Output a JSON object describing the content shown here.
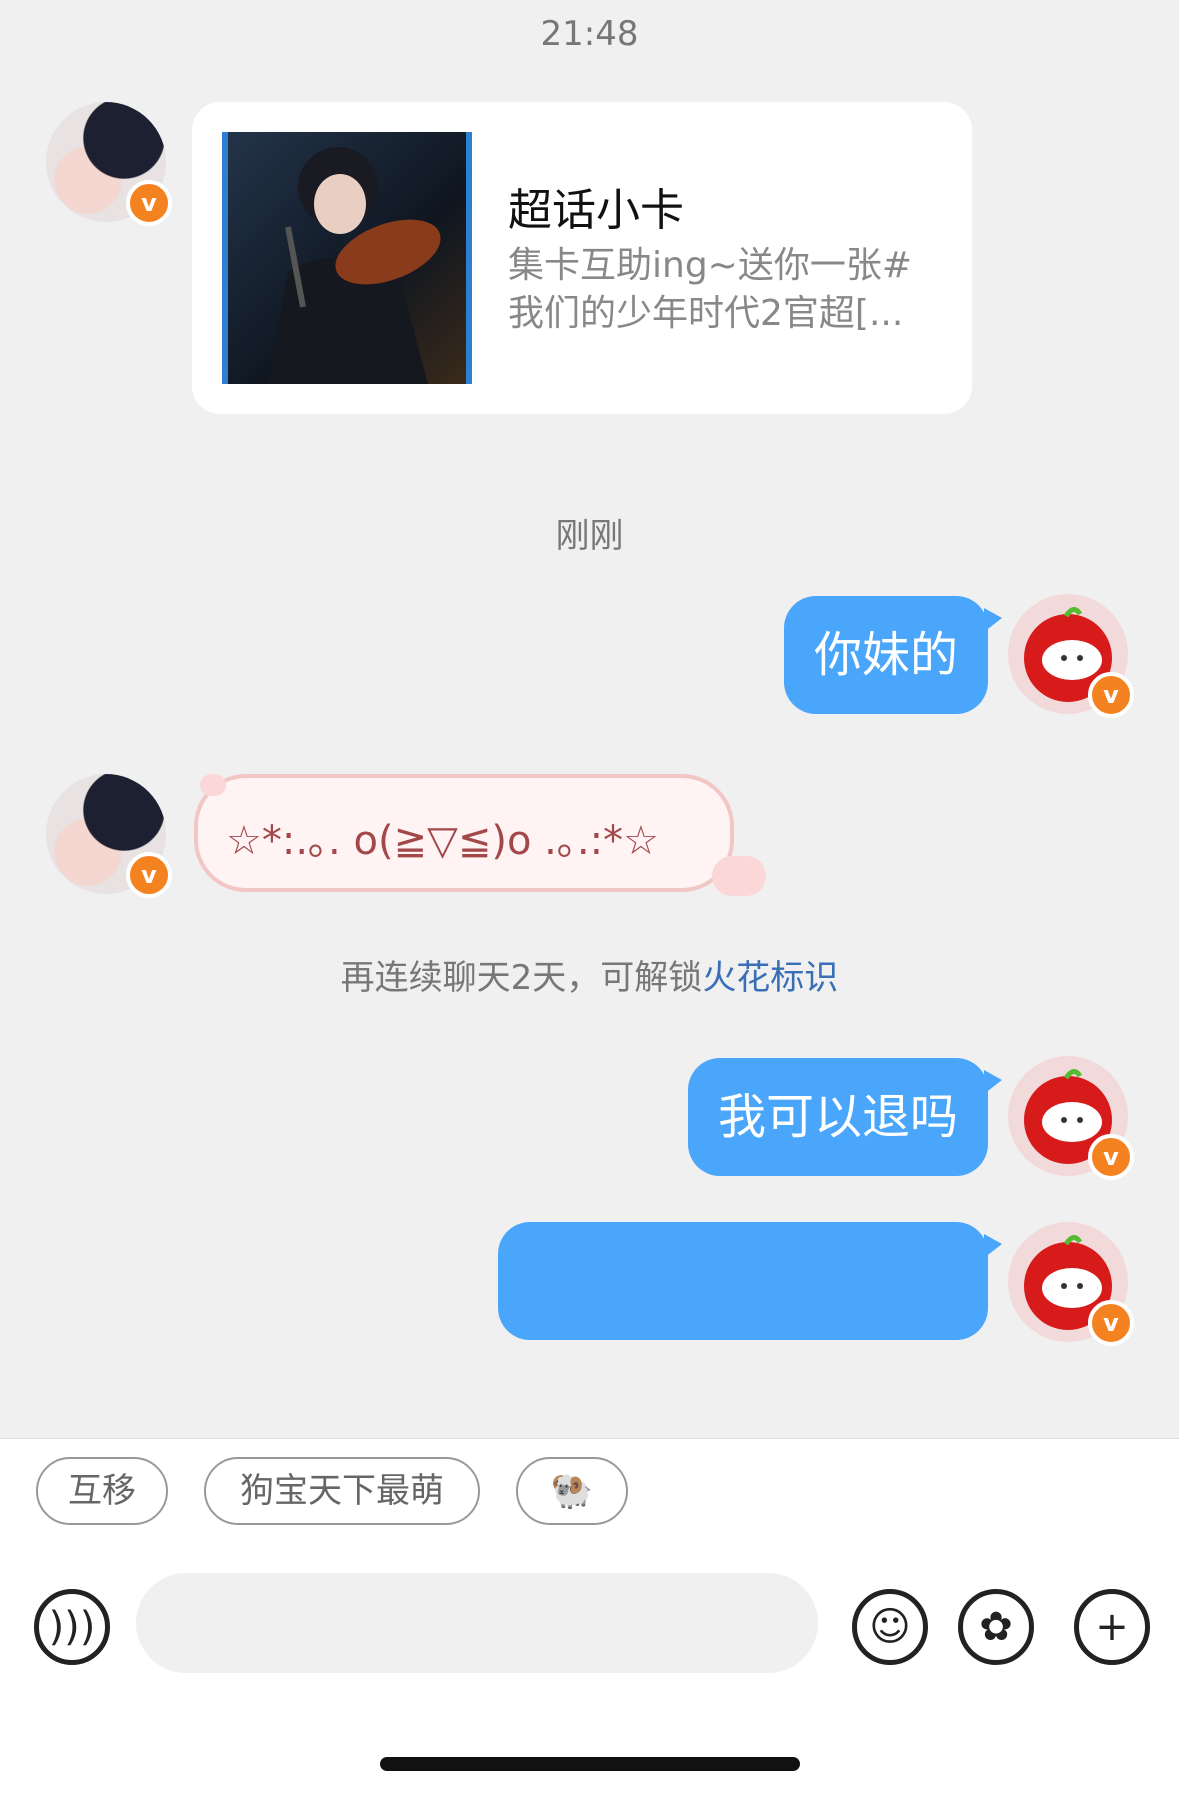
{
  "timestamps": {
    "first": "21:48",
    "second": "刚刚"
  },
  "card": {
    "title": "超话小卡",
    "desc": "集卡互助ing~送你一张#我们的少年时代2官超[..."
  },
  "messages": {
    "out1": "你妹的",
    "in_kaomoji": "☆*:.｡. o(≧▽≦)o .｡.:*☆",
    "out2": "我可以退吗"
  },
  "system": {
    "prefix": "再连续聊天2天，可解锁",
    "link": "火花标识"
  },
  "quick_replies": [
    "互移",
    "狗宝天下最萌",
    "🐏"
  ],
  "input": {
    "placeholder": ""
  },
  "colors": {
    "bubble_out": "#4aa6fb",
    "badge": "#f58220",
    "link": "#3a6fb7"
  }
}
